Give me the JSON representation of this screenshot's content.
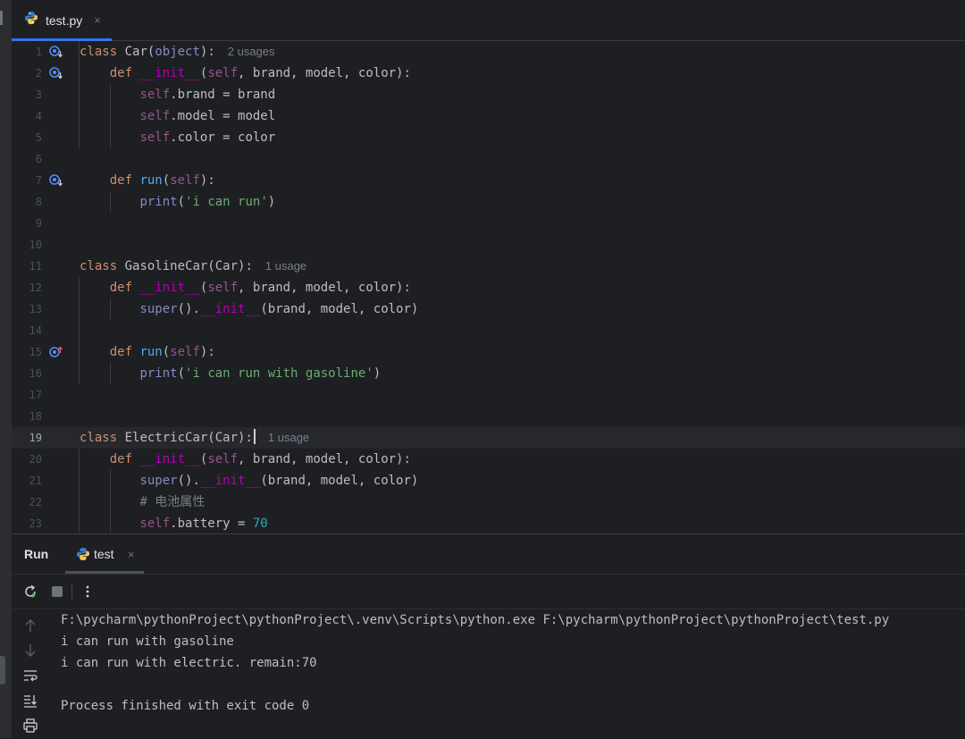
{
  "editor_tab": {
    "file_name": "test.py",
    "close_symbol": "×"
  },
  "code_lines": [
    {
      "num": "1",
      "hint": "2 usages"
    },
    {
      "num": "2"
    },
    {
      "num": "3"
    },
    {
      "num": "4"
    },
    {
      "num": "5"
    },
    {
      "num": "6"
    },
    {
      "num": "7"
    },
    {
      "num": "8"
    },
    {
      "num": "9"
    },
    {
      "num": "10"
    },
    {
      "num": "11",
      "hint": "1 usage"
    },
    {
      "num": "12"
    },
    {
      "num": "13"
    },
    {
      "num": "14"
    },
    {
      "num": "15"
    },
    {
      "num": "16"
    },
    {
      "num": "17"
    },
    {
      "num": "18"
    },
    {
      "num": "19",
      "hint": "1 usage"
    },
    {
      "num": "20"
    },
    {
      "num": "21"
    },
    {
      "num": "22"
    },
    {
      "num": "23"
    }
  ],
  "code": {
    "l1": {
      "kw": "class",
      "name": "Car(",
      "base": "object",
      "rest": "):"
    },
    "l2": {
      "kw": "def",
      "fn": "__init__",
      "open": "(",
      "self": "self",
      "rest": ", brand, model, color):"
    },
    "l3": {
      "self": "self",
      "rest": ".brand = brand"
    },
    "l4": {
      "self": "self",
      "rest": ".model = model"
    },
    "l5": {
      "self": "self",
      "rest": ".color = color"
    },
    "l7": {
      "kw": "def",
      "fn": "run",
      "open": "(",
      "self": "self",
      "rest": "):"
    },
    "l8": {
      "print": "print",
      "open": "(",
      "str": "'i can run'",
      "close": ")"
    },
    "l11": {
      "kw": "class",
      "name": "GasolineCar(Car):"
    },
    "l12": {
      "kw": "def",
      "fn": "__init__",
      "open": "(",
      "self": "self",
      "rest": ", brand, model, color):"
    },
    "l13": {
      "super": "super",
      "mid": "().",
      "fn": "__init__",
      "rest": "(brand, model, color)"
    },
    "l15": {
      "kw": "def",
      "fn": "run",
      "open": "(",
      "self": "self",
      "rest": "):"
    },
    "l16": {
      "print": "print",
      "open": "(",
      "str": "'i can run with gasoline'",
      "close": ")"
    },
    "l19": {
      "kw": "class",
      "name": "ElectricCar(Car):"
    },
    "l20": {
      "kw": "def",
      "fn": "__init__",
      "open": "(",
      "self": "self",
      "rest": ", brand, model, color):"
    },
    "l21": {
      "super": "super",
      "mid": "().",
      "fn": "__init__",
      "rest": "(brand, model, color)"
    },
    "l22": {
      "comment": "# 电池属性"
    },
    "l23": {
      "self": "self",
      "rest": ".battery = ",
      "num": "70"
    }
  },
  "run_panel": {
    "title": "Run",
    "tab_label": "test",
    "close_symbol": "×",
    "output": [
      "F:\\pycharm\\pythonProject\\pythonProject\\.venv\\Scripts\\python.exe F:\\pycharm\\pythonProject\\pythonProject\\test.py",
      "i can run with gasoline",
      "i can run with electric. remain:70",
      "",
      "Process finished with exit code 0"
    ]
  },
  "colors": {
    "background": "#1e1f22",
    "keyword": "#cf8e6d",
    "self": "#94558d",
    "string": "#6aab73",
    "number": "#2aacb8",
    "function": "#56a8f5",
    "dunder": "#b200b2",
    "accent": "#3574f0"
  },
  "icons": [
    "python-file-icon",
    "override-marker-icon",
    "overridden-up-icon",
    "rerun-icon",
    "stop-icon",
    "more-options-icon",
    "scroll-up-icon",
    "scroll-down-icon",
    "soft-wrap-icon",
    "scroll-to-end-icon",
    "print-icon"
  ]
}
